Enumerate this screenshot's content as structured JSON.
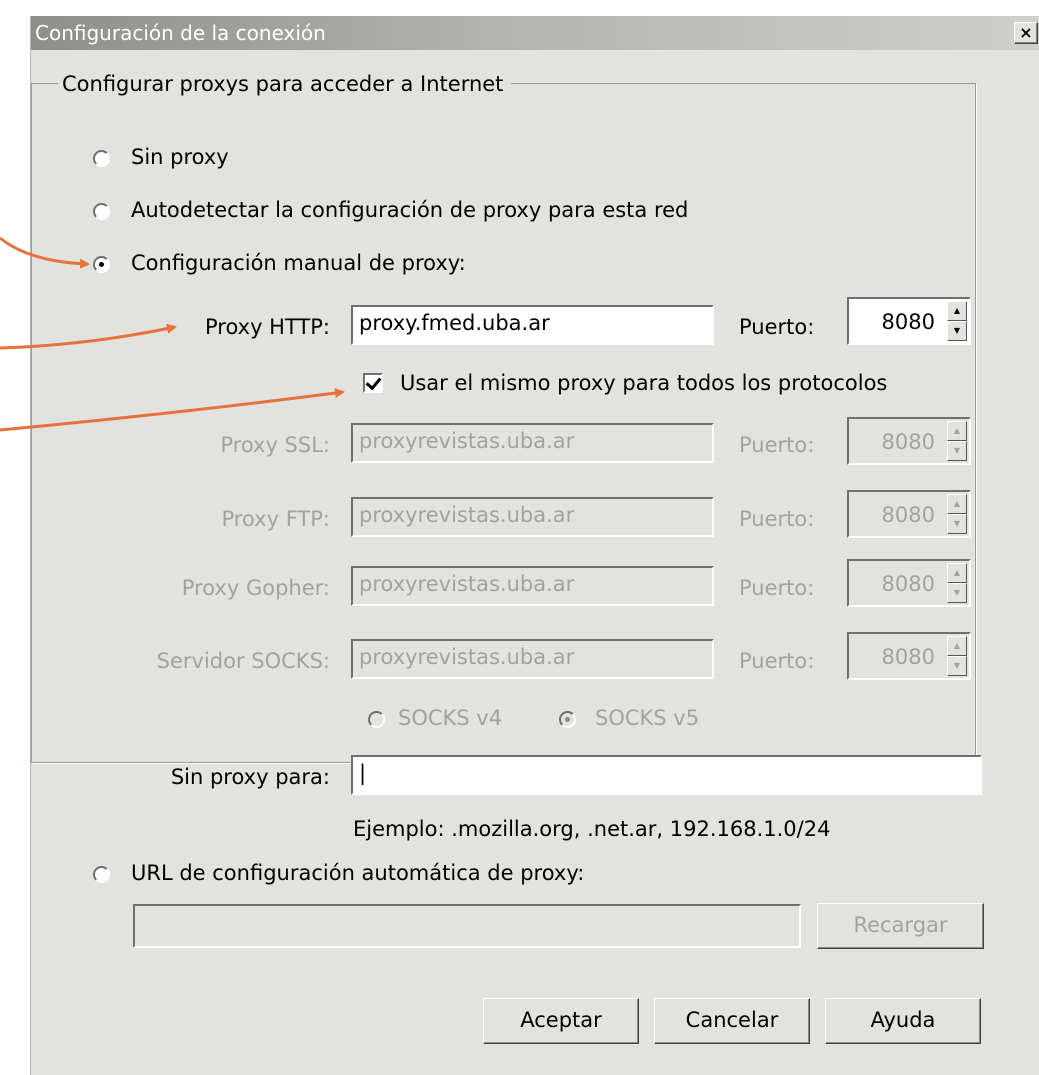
{
  "window": {
    "title": "Configuración de la conexión",
    "close_label": "×"
  },
  "group": {
    "legend": "Configurar proxys para acceder a Internet"
  },
  "options": {
    "no_proxy": "Sin proxy",
    "autodetect": "Autodetectar la configuración de proxy para esta red",
    "manual": "Configuración manual de proxy:",
    "auto_url": "URL de configuración automática de proxy:",
    "selected": "manual"
  },
  "http": {
    "label": "Proxy HTTP:",
    "value": "proxy.fmed.uba.ar",
    "port_label": "Puerto:",
    "port": "8080"
  },
  "same_proxy": {
    "label": "Usar el mismo proxy para todos los protocolos",
    "checked": true
  },
  "ssl": {
    "label": "Proxy SSL:",
    "value": "proxyrevistas.uba.ar",
    "port_label": "Puerto:",
    "port": "8080"
  },
  "ftp": {
    "label": "Proxy FTP:",
    "value": "proxyrevistas.uba.ar",
    "port_label": "Puerto:",
    "port": "8080"
  },
  "gopher": {
    "label": "Proxy Gopher:",
    "value": "proxyrevistas.uba.ar",
    "port_label": "Puerto:",
    "port": "8080"
  },
  "socks": {
    "label": "Servidor SOCKS:",
    "value": "proxyrevistas.uba.ar",
    "port_label": "Puerto:",
    "port": "8080",
    "v4": "SOCKS v4",
    "v5": "SOCKS v5",
    "version_selected": "v5"
  },
  "no_proxy_for": {
    "label": "Sin proxy para:",
    "value": "|",
    "example": "Ejemplo: .mozilla.org, .net.ar, 192.168.1.0/24"
  },
  "auto_url_field": {
    "value": "",
    "reload": "Recargar"
  },
  "buttons": {
    "ok": "Aceptar",
    "cancel": "Cancelar",
    "help": "Ayuda"
  },
  "colors": {
    "dialog_bg": "#e2e2de",
    "annotation_arrow": "#e8703a",
    "disabled_text": "#a2a29e"
  }
}
